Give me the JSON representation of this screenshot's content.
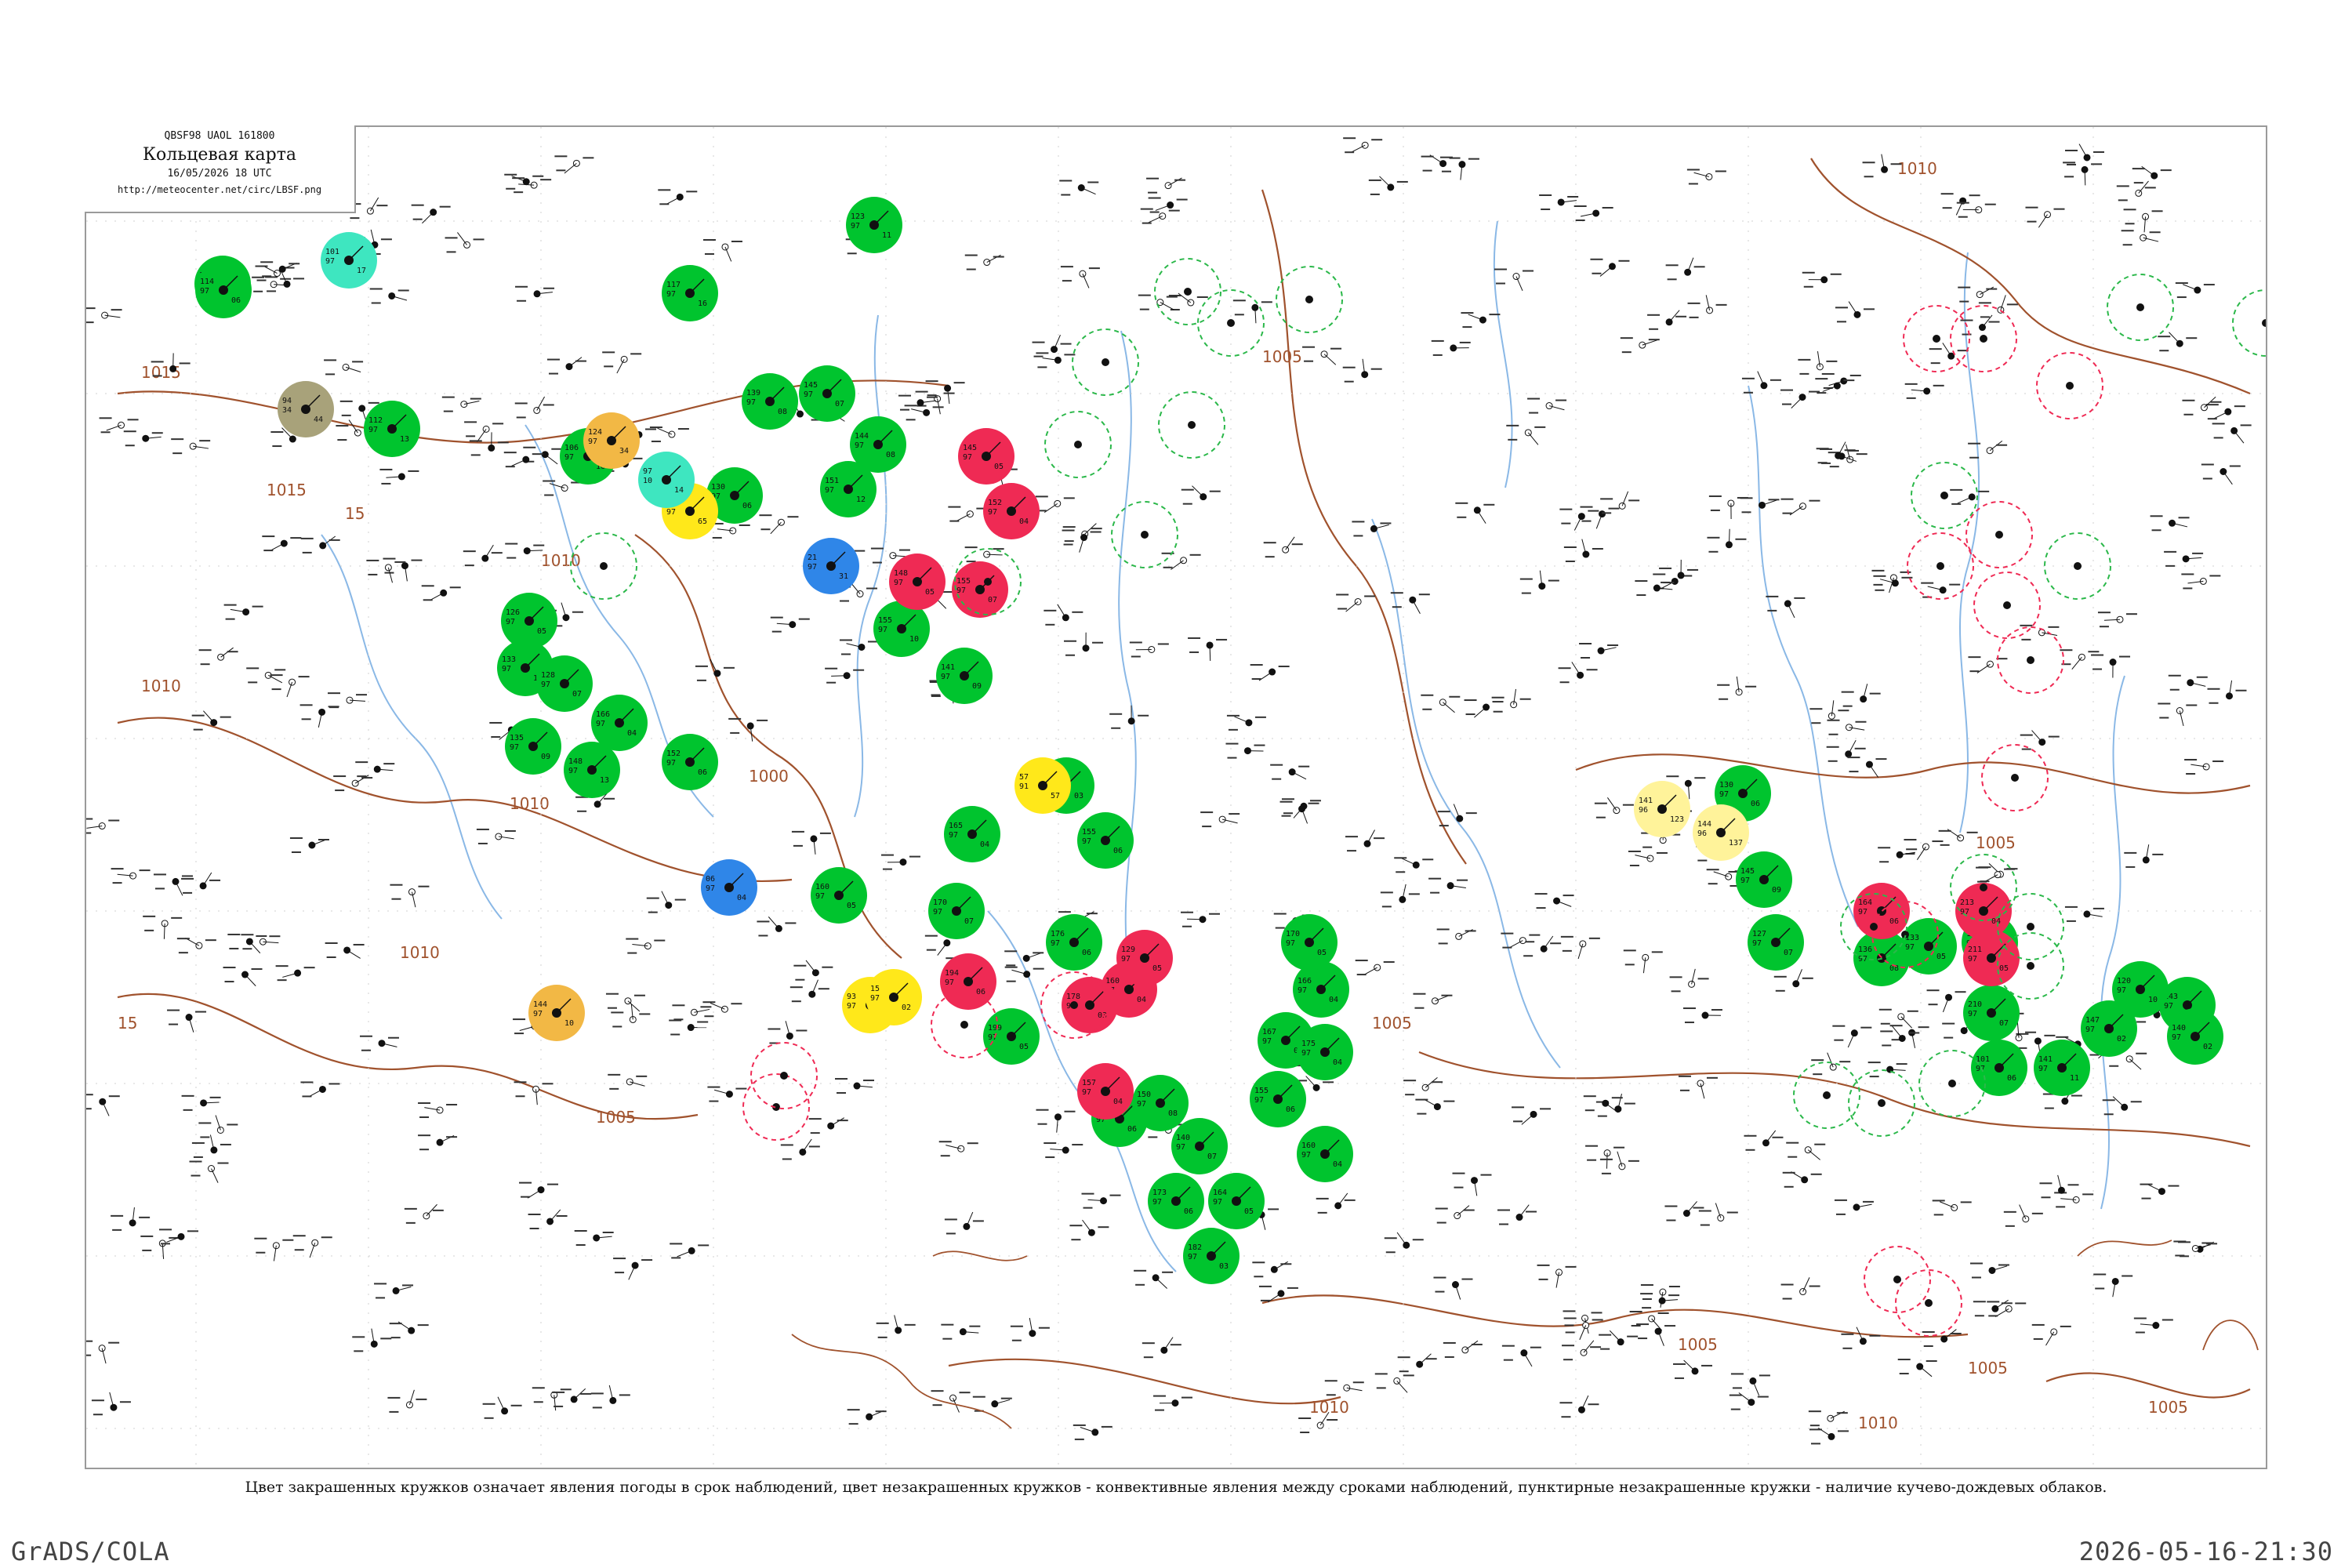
{
  "map": {
    "bulletin_code": "QBSF98  UAOL  161800",
    "title": "Кольцевая карта",
    "time": "16/05/2026 18 UTC",
    "url": "http://meteocenter.net/circ/LBSF.png"
  },
  "caption": "Цвет закрашенных кружков означает явления погоды в срок наблюдений, цвет незакрашенных кружков - конвективные явления между сроками наблюдений, пунктирные незакрашенные кружки - наличие кучево-дождевых облаков.",
  "footer": {
    "left": "GrADS/COLA",
    "right": "2026-05-16-21:30"
  },
  "colors": {
    "green": "#00c42e",
    "red": "#ef2a54",
    "yellow": "#ffe81a",
    "orange": "#f2b845",
    "cyan": "#3ee6c0",
    "blue": "#2f86e8",
    "olive": "#a8a27a",
    "pale_yellow": "#fff39a",
    "isobar": "#a0522d",
    "river": "#8ab8e6",
    "border": "#9a9a9a"
  },
  "isobar_labels": [
    "1015",
    "1015",
    "1010",
    "1010",
    "1010",
    "1005",
    "1005",
    "1010",
    "1005",
    "1005",
    "1005",
    "1010",
    "1005",
    "15",
    "15",
    "1010",
    "1010",
    "1005",
    "1000"
  ],
  "stations": {
    "filled": [
      {
        "color": "green",
        "values": [
          "111",
          "97",
          "14"
        ]
      },
      {
        "color": "green",
        "values": [
          "114",
          "97",
          "06"
        ]
      },
      {
        "color": "green",
        "values": [
          "112",
          "97",
          "13"
        ]
      },
      {
        "color": "green",
        "values": [
          "106",
          "97",
          "16"
        ]
      },
      {
        "color": "green",
        "values": [
          "117",
          "97",
          "16"
        ]
      },
      {
        "color": "green",
        "values": [
          "123",
          "97",
          "11"
        ]
      },
      {
        "color": "green",
        "values": [
          "139",
          "97",
          "08"
        ]
      },
      {
        "color": "green",
        "values": [
          "130",
          "97",
          "06"
        ]
      },
      {
        "color": "green",
        "values": [
          "145",
          "97",
          "07"
        ]
      },
      {
        "color": "green",
        "values": [
          "151",
          "97",
          "12"
        ]
      },
      {
        "color": "green",
        "values": [
          "144",
          "97",
          "08"
        ]
      },
      {
        "color": "green",
        "values": [
          "155",
          "97",
          "10"
        ]
      },
      {
        "color": "green",
        "values": [
          "141",
          "97",
          "09"
        ]
      },
      {
        "color": "green",
        "values": [
          "126",
          "97",
          "05"
        ]
      },
      {
        "color": "green",
        "values": [
          "133",
          "97",
          "11"
        ]
      },
      {
        "color": "green",
        "values": [
          "128",
          "97",
          "07"
        ]
      },
      {
        "color": "green",
        "values": [
          "135",
          "97",
          "09"
        ]
      },
      {
        "color": "green",
        "values": [
          "148",
          "97",
          "13"
        ]
      },
      {
        "color": "green",
        "values": [
          "152",
          "97",
          "06"
        ]
      },
      {
        "color": "green",
        "values": [
          "166",
          "97",
          "04"
        ]
      },
      {
        "color": "green",
        "values": [
          "160",
          "97",
          "05"
        ]
      },
      {
        "color": "green",
        "values": [
          "170",
          "97",
          "07"
        ]
      },
      {
        "color": "green",
        "values": [
          "165",
          "97",
          "04"
        ]
      },
      {
        "color": "green",
        "values": [
          "185",
          "97",
          "03"
        ]
      },
      {
        "color": "green",
        "values": [
          "176",
          "97",
          "06"
        ]
      },
      {
        "color": "green",
        "values": [
          "155",
          "97",
          "06"
        ]
      },
      {
        "color": "green",
        "values": [
          "199",
          "97",
          "05"
        ]
      },
      {
        "color": "green",
        "values": [
          "149",
          "97",
          "06"
        ]
      },
      {
        "color": "green",
        "values": [
          "150",
          "97",
          "08"
        ]
      },
      {
        "color": "green",
        "values": [
          "140",
          "97",
          "07"
        ]
      },
      {
        "color": "green",
        "values": [
          "173",
          "97",
          "06"
        ]
      },
      {
        "color": "green",
        "values": [
          "182",
          "97",
          "03"
        ]
      },
      {
        "color": "green",
        "values": [
          "164",
          "97",
          "05"
        ]
      },
      {
        "color": "green",
        "values": [
          "167",
          "97",
          "05"
        ]
      },
      {
        "color": "green",
        "values": [
          "166",
          "97",
          "04"
        ]
      },
      {
        "color": "green",
        "values": [
          "170",
          "97",
          "05"
        ]
      },
      {
        "color": "green",
        "values": [
          "175",
          "97",
          "04"
        ]
      },
      {
        "color": "green",
        "values": [
          "155",
          "97",
          "06"
        ]
      },
      {
        "color": "green",
        "values": [
          "160",
          "97",
          "04"
        ]
      },
      {
        "color": "green",
        "values": [
          "130",
          "97",
          "06"
        ]
      },
      {
        "color": "green",
        "values": [
          "145",
          "97",
          "09"
        ]
      },
      {
        "color": "green",
        "values": [
          "127",
          "97",
          "07"
        ]
      },
      {
        "color": "green",
        "values": [
          "136",
          "97",
          "08"
        ]
      },
      {
        "color": "green",
        "values": [
          "133",
          "97",
          "05"
        ]
      },
      {
        "color": "green",
        "values": [
          "115",
          "97",
          "04"
        ]
      },
      {
        "color": "green",
        "values": [
          "101",
          "97",
          "06"
        ]
      },
      {
        "color": "green",
        "values": [
          "210",
          "97",
          "07"
        ]
      },
      {
        "color": "green",
        "values": [
          "143",
          "97",
          "12"
        ]
      },
      {
        "color": "green",
        "values": [
          "140",
          "97",
          "02"
        ]
      },
      {
        "color": "green",
        "values": [
          "120",
          "97",
          "10"
        ]
      },
      {
        "color": "green",
        "values": [
          "147",
          "97",
          "02"
        ]
      },
      {
        "color": "green",
        "values": [
          "141",
          "97",
          "11"
        ]
      },
      {
        "color": "red",
        "values": [
          "145",
          "97",
          "05"
        ]
      },
      {
        "color": "red",
        "values": [
          "152",
          "97",
          "04"
        ]
      },
      {
        "color": "red",
        "values": [
          "155",
          "97",
          "07"
        ]
      },
      {
        "color": "red",
        "values": [
          "148",
          "97",
          "05"
        ]
      },
      {
        "color": "red",
        "values": [
          "160",
          "97",
          "04"
        ]
      },
      {
        "color": "red",
        "values": [
          "178",
          "97",
          "03"
        ]
      },
      {
        "color": "red",
        "values": [
          "157",
          "97",
          "04"
        ]
      },
      {
        "color": "red",
        "values": [
          "194",
          "97",
          "06"
        ]
      },
      {
        "color": "red",
        "values": [
          "129",
          "97",
          "05"
        ]
      },
      {
        "color": "red",
        "values": [
          "164",
          "97",
          "06"
        ]
      },
      {
        "color": "red",
        "values": [
          "213",
          "97",
          "04"
        ]
      },
      {
        "color": "red",
        "values": [
          "211",
          "97",
          "05"
        ]
      },
      {
        "color": "yellow",
        "values": [
          "13",
          "97",
          "65"
        ]
      },
      {
        "color": "yellow",
        "values": [
          "57",
          "91",
          "57"
        ]
      },
      {
        "color": "yellow",
        "values": [
          "93",
          "97",
          "06"
        ]
      },
      {
        "color": "yellow",
        "values": [
          "15",
          "97",
          "02"
        ]
      },
      {
        "color": "orange",
        "values": [
          "124",
          "97",
          "34"
        ]
      },
      {
        "color": "orange",
        "values": [
          "144",
          "97",
          "10"
        ]
      },
      {
        "color": "cyan",
        "values": [
          "97",
          "10",
          "14"
        ]
      },
      {
        "color": "cyan",
        "values": [
          "101",
          "97",
          "17"
        ]
      },
      {
        "color": "blue",
        "values": [
          "21",
          "97",
          "31"
        ]
      },
      {
        "color": "blue",
        "values": [
          "06",
          "97",
          "04"
        ]
      },
      {
        "color": "olive",
        "values": [
          "94",
          "34",
          "44"
        ]
      },
      {
        "color": "pale_yellow",
        "values": [
          "141",
          "96",
          "123"
        ]
      },
      {
        "color": "pale_yellow",
        "values": [
          "144",
          "96",
          "137"
        ]
      }
    ]
  }
}
